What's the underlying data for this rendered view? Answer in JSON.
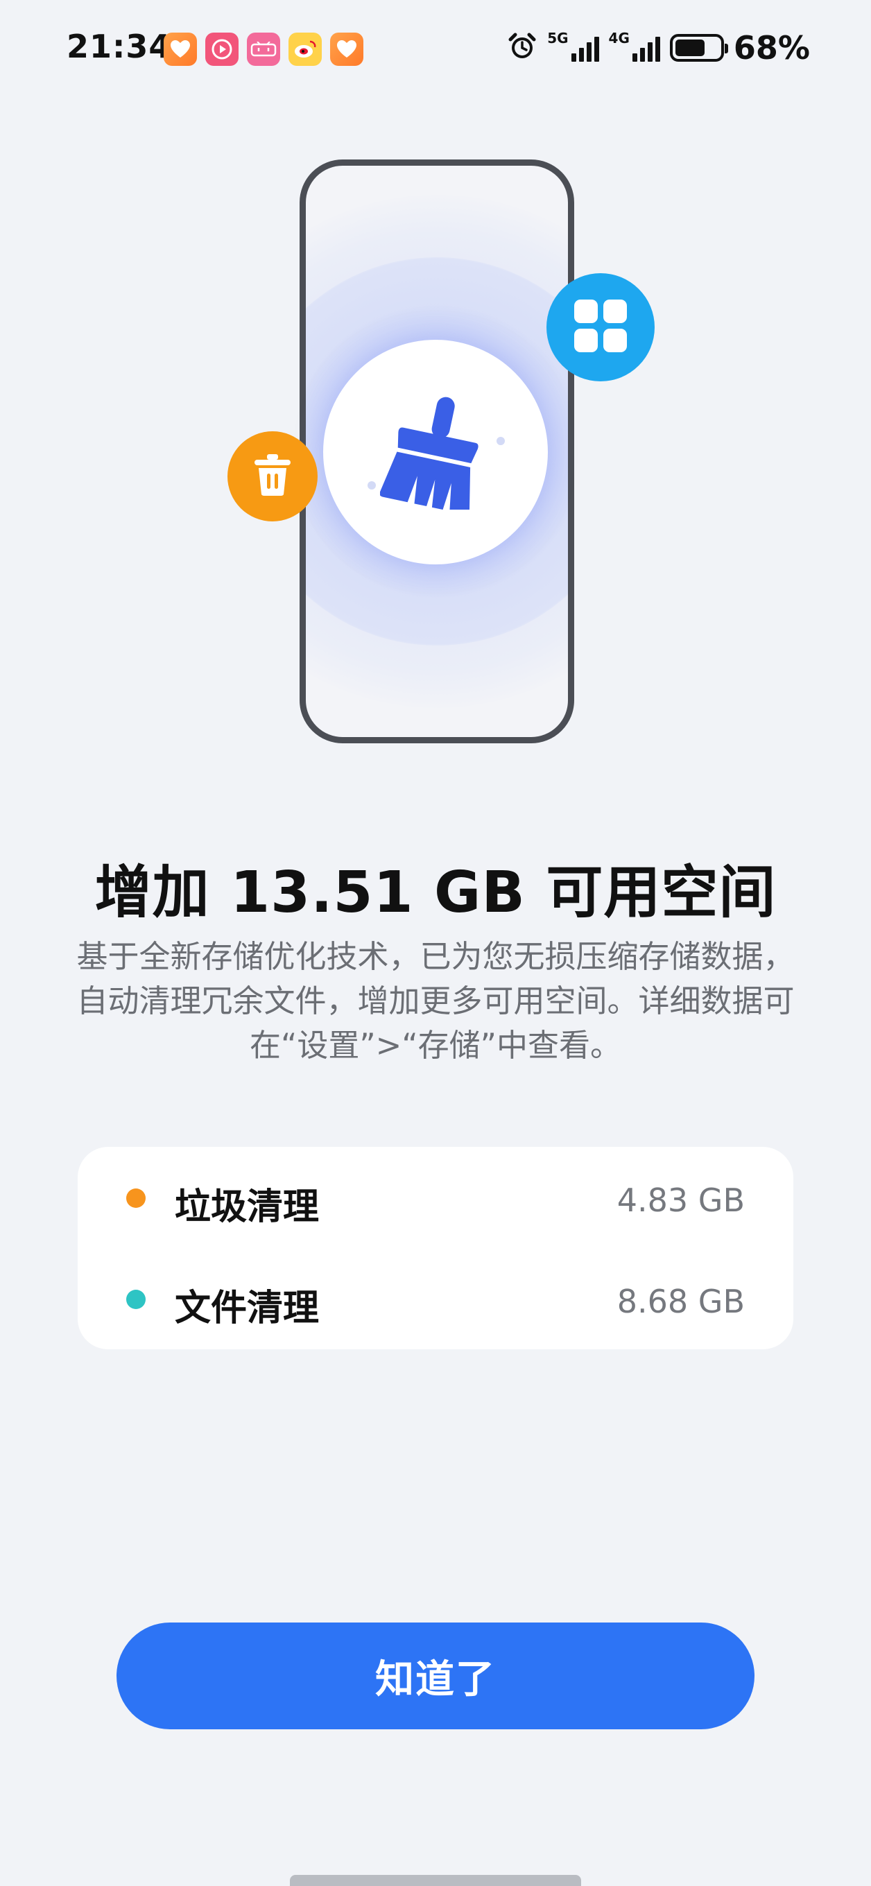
{
  "status_bar": {
    "time": "21:34",
    "app_icons": [
      "heart-app-icon",
      "video-app-icon",
      "bilibili-app-icon",
      "weibo-app-icon",
      "heart-app-icon"
    ],
    "network_1": "5G",
    "network_2": "4G",
    "battery_percent": "68%",
    "battery_level": 0.68
  },
  "hero": {
    "icons": [
      "broom-icon",
      "trash-icon",
      "apps-grid-icon"
    ],
    "colors": {
      "broom": "#3a5fe6",
      "trash_badge": "#f79a13",
      "apps_badge": "#1ea7ef"
    }
  },
  "content": {
    "headline": "增加 13.51 GB 可用空间",
    "description": "基于全新存储优化技术，已为您无损压缩存储数据，自动清理冗余文件，增加更多可用空间。详细数据可在“设置”>“存储”中查看。"
  },
  "summary": {
    "items": [
      {
        "label": "垃圾清理",
        "value": "4.83 GB",
        "color": "#f7941d"
      },
      {
        "label": "文件清理",
        "value": "8.68 GB",
        "color": "#2ec4c4"
      }
    ]
  },
  "actions": {
    "confirm_label": "知道了",
    "accent": "#2d74f5"
  }
}
